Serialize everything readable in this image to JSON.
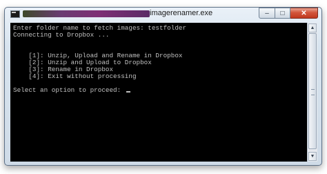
{
  "window": {
    "title": "imagerenamer.exe",
    "controls": {
      "minimize": "–",
      "maximize": "□",
      "close": "✕"
    },
    "icon": "console-app-icon"
  },
  "console": {
    "lines": [
      "Enter folder name to fetch images: testfolder",
      "Connecting to Dropbox ...",
      "",
      "",
      "    [1]: Unzip, Upload and Rename in Dropbox",
      "    [2]: Unzip and Upload to Dropbox",
      "    [3]: Rename in Dropbox",
      "    [4]: Exit without processing",
      "",
      "Select an option to proceed: "
    ]
  },
  "scrollbar": {
    "up": "▲",
    "down": "▼"
  }
}
